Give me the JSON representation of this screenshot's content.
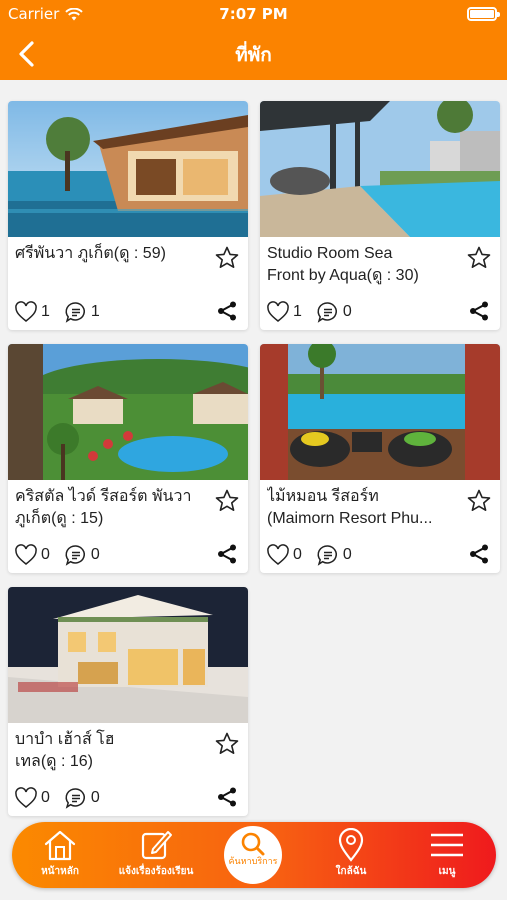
{
  "status_bar": {
    "carrier": "Carrier",
    "time": "7:07 PM"
  },
  "header": {
    "title": "ที่พัก"
  },
  "listings": [
    {
      "name": "ศรีพันวา ภูเก็ต(ดู : 59)",
      "likes": "1",
      "comments": "1"
    },
    {
      "name": "Studio Room Sea\nFront by Aqua(ดู : 30)",
      "likes": "1",
      "comments": "0"
    },
    {
      "name": "คริสตัล ไวด์ รีสอร์ต พันวา\nภูเก็ต(ดู : 15)",
      "likes": "0",
      "comments": "0"
    },
    {
      "name": "ไม้หมอน รีสอร์ท\n(Maimorn Resort Phu...",
      "likes": "0",
      "comments": "0"
    },
    {
      "name": "บาบำ เฮ้าส์ โฮ\nเทล(ดู : 16)",
      "likes": "0",
      "comments": "0"
    }
  ],
  "tab_bar": {
    "home": "หน้าหลัก",
    "report": "แจ้งเรื่องร้องเรียน",
    "search": "ค้นหาบริการ",
    "nearby": "ใกล้ฉัน",
    "menu": "เมนู"
  },
  "colors": {
    "brand": "#fb8300",
    "tab_gradient_end": "#ef1a1d"
  },
  "icons": [
    "back-chevron-icon",
    "star-icon",
    "heart-icon",
    "comment-icon",
    "share-icon",
    "home-icon",
    "edit-icon",
    "search-icon",
    "location-pin-icon",
    "menu-icon"
  ]
}
